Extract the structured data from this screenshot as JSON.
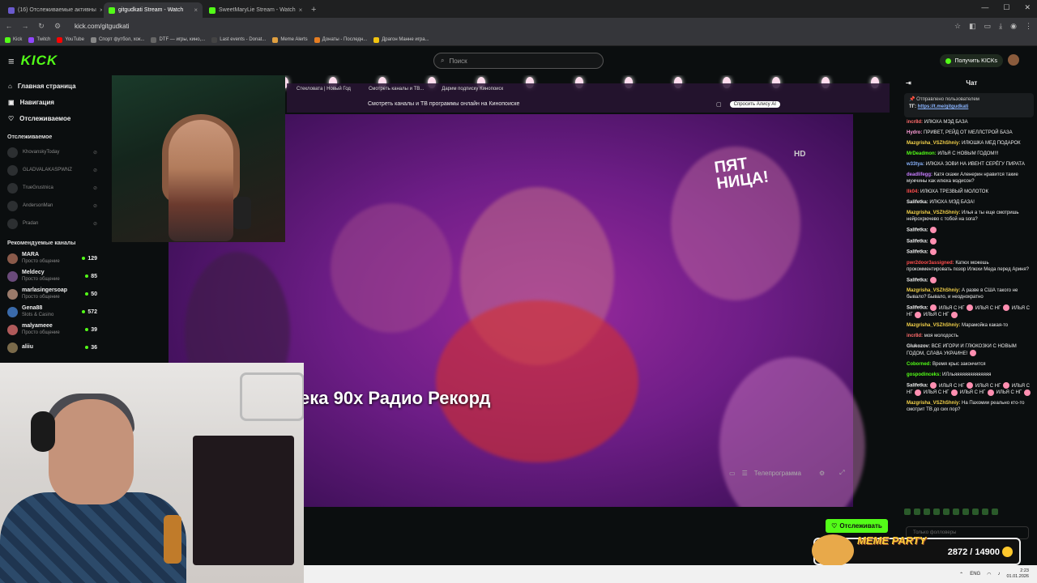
{
  "browser": {
    "tabs": [
      {
        "label": "(16) Отслеживаемые активны",
        "color": "#6a5acd",
        "active": false
      },
      {
        "label": "gitgudkati Stream - Watch",
        "color": "#53fc18",
        "active": true
      },
      {
        "label": "SweetMaryLie Stream - Watch",
        "color": "#53fc18",
        "active": false
      }
    ],
    "new_tab": "+",
    "url": "kick.com/gitgudkati",
    "bookmarks": [
      "Kick",
      "Twitch",
      "YouTube",
      "Спорт футбол, хок...",
      "DTF — игры, кино,...",
      "Last events - Donat...",
      "Meme Alerts",
      "Донаты - Последн...",
      "Драгон Манне игра..."
    ]
  },
  "kick": {
    "logo": "KICK",
    "search_placeholder": "Поиск",
    "get_kicks": "Получить KICKs",
    "nav": [
      {
        "label": "Главная страница",
        "icon": "home-icon",
        "glyph": "⌂"
      },
      {
        "label": "Навигация",
        "icon": "browse-icon",
        "glyph": "▣"
      },
      {
        "label": "Отслеживаемое",
        "icon": "heart-icon",
        "glyph": "♡"
      }
    ],
    "followed_header": "Отслеживаемое",
    "followed": [
      "KhovanskyToday",
      "GLADVALAKASPWNZ",
      "TrueGrustnica",
      "AndersonMan",
      "Pradan"
    ],
    "recommended_header": "Рекомендуемые каналы",
    "recommended": [
      {
        "name": "MARA",
        "category": "Просто общение",
        "viewers": "129",
        "color": "#8a5a4a"
      },
      {
        "name": "Meldecy",
        "category": "Просто общение",
        "viewers": "85",
        "color": "#6a4a7a"
      },
      {
        "name": "marlasingersoap",
        "category": "Просто общение",
        "viewers": "50",
        "color": "#9a7a6a"
      },
      {
        "name": "Gena88",
        "category": "Slots & Casino",
        "viewers": "572",
        "color": "#3a6aaa"
      },
      {
        "name": "malyameee",
        "category": "Просто общение",
        "viewers": "39",
        "color": "#b05a5a"
      },
      {
        "name": "aliiu",
        "category": "",
        "viewers": "36",
        "color": "#7a6a4a"
      }
    ]
  },
  "video": {
    "inner_tabs": [
      "Стекловата | Новый Год",
      "Смотреть каналы и ТВ...",
      "Дарим подписку Кинопоиск"
    ],
    "inner_title": "Смотреть каналы и ТВ программы онлайн на Кинопоиске",
    "alisa_button": "Спросить Алису AI",
    "overlay_text": "ека 90х Радио Рекорд",
    "channel_logo": "ПЯТ\nНИЦА!",
    "hd_label": "HD",
    "tv_program": "Телепрограмма"
  },
  "chat": {
    "title": "Чат",
    "pinned_header": "Отправлено пользователем",
    "pinned_text": "ТГ:",
    "pinned_link": "https://t.me/gitgudkati",
    "messages": [
      {
        "user": "incr8d:",
        "color": "#ff6b6b",
        "text": "ИЛЮХА МЭД БАЗА"
      },
      {
        "user": "Hydro:",
        "color": "#ff9ed8",
        "text": "ПРИВЕТ, РЕЙД ОТ МЕЛЛСТРОЙ БАЗА"
      },
      {
        "user": "Mazgrisha_VSZhShniy:",
        "color": "#f3d14a",
        "text": "ИЛЮШКА МЕД ПОДАРОК"
      },
      {
        "user": "MrDeadmon:",
        "color": "#53fc18",
        "text": "ИЛЬЯ С НОВЫМ ГОДОМ!!!"
      },
      {
        "user": "w33tya:",
        "color": "#8ab4ff",
        "text": "ИЛЮХА ЗОВИ НА ИВЕНТ СЕРЁГУ ПИРАТА"
      },
      {
        "user": "deadlifegg:",
        "color": "#c77dff",
        "text": "Катя скажи Аленерин нравится такие мужчины как илюха мэдисон?"
      },
      {
        "user": "Ilk04:",
        "color": "#ff4d4d",
        "text": "ИЛЮХА ТРЕЗВЫЙ МОЛОТОК"
      },
      {
        "user": "Salifetka:",
        "color": "#eeeeee",
        "text": "ИЛЮХА МЭД БАЗА!"
      },
      {
        "user": "Mazgrisha_VSZhShniy:",
        "color": "#f3d14a",
        "text": "Илья а ты еще смотришь нейрохрючево с тобой на sora?"
      },
      {
        "user": "Salifetka:",
        "color": "#eeeeee",
        "text": "♥"
      },
      {
        "user": "Salifetka:",
        "color": "#eeeeee",
        "text": "♥"
      },
      {
        "user": "Salifetka:",
        "color": "#eeeeee",
        "text": "♥"
      },
      {
        "user": "pwr2door3assigned:",
        "color": "#ff4d4d",
        "text": "Катюх можешь прокомментировать позор Илюхи Меда перед Ариня?"
      },
      {
        "user": "Salifetka:",
        "color": "#eeeeee",
        "text": "♥"
      },
      {
        "user": "Mazgrisha_VSZhShniy:",
        "color": "#f3d14a",
        "text": "А разве в США такого не бывало? Бывало, и неоднократно"
      },
      {
        "user": "Salifetka:",
        "color": "#eeeeee",
        "text": "♥ ИЛЬЯ С НГ ♥ ИЛЬЯ С НГ ♥ ИЛЬЯ С НГ ♥ ИЛЬЯ С НГ ♥"
      },
      {
        "user": "Mazgrisha_VSZhShniy:",
        "color": "#f3d14a",
        "text": "Марамойка какая-то"
      },
      {
        "user": "incr8d:",
        "color": "#ff6b6b",
        "text": "моя молодость"
      },
      {
        "user": "Glukozov:",
        "color": "#eeeeee",
        "text": "ВСЕ ИГОРИ И ГЛЮКОЗКИ С НОВЫМ ГОДОМ, СЛАВА УКРАИНЕ! ♥"
      },
      {
        "user": "Coborned:",
        "color": "#53fc18",
        "text": "Время крыс закончится"
      },
      {
        "user": "gospodinceks:",
        "color": "#53fc18",
        "text": "ИЛльяяяяяяяяяяяяяя"
      },
      {
        "user": "Salifetka:",
        "color": "#eeeeee",
        "text": "♥ ИЛЬЯ С НГ ♥ ИЛЬЯ С НГ ♥ ИЛЬЯ С НГ ♥ ИЛЬЯ С НГ ♥ ИЛЬЯ С НГ ♥ ИЛЬЯ С НГ ♥"
      },
      {
        "user": "Mazgrisha_VSZhShniy:",
        "color": "#f3d14a",
        "text": "На Пахомии реально кто-то смотрит ТВ до сих пор?"
      }
    ],
    "input_placeholder": "Только фолловеры",
    "follow_button": "Отслеживать"
  },
  "meme_party": {
    "title": "MEME PARTY",
    "count": "2872 / 14900"
  },
  "taskbar": {
    "lang": "ENG",
    "time": "2:23",
    "date": "01.01.2026"
  }
}
